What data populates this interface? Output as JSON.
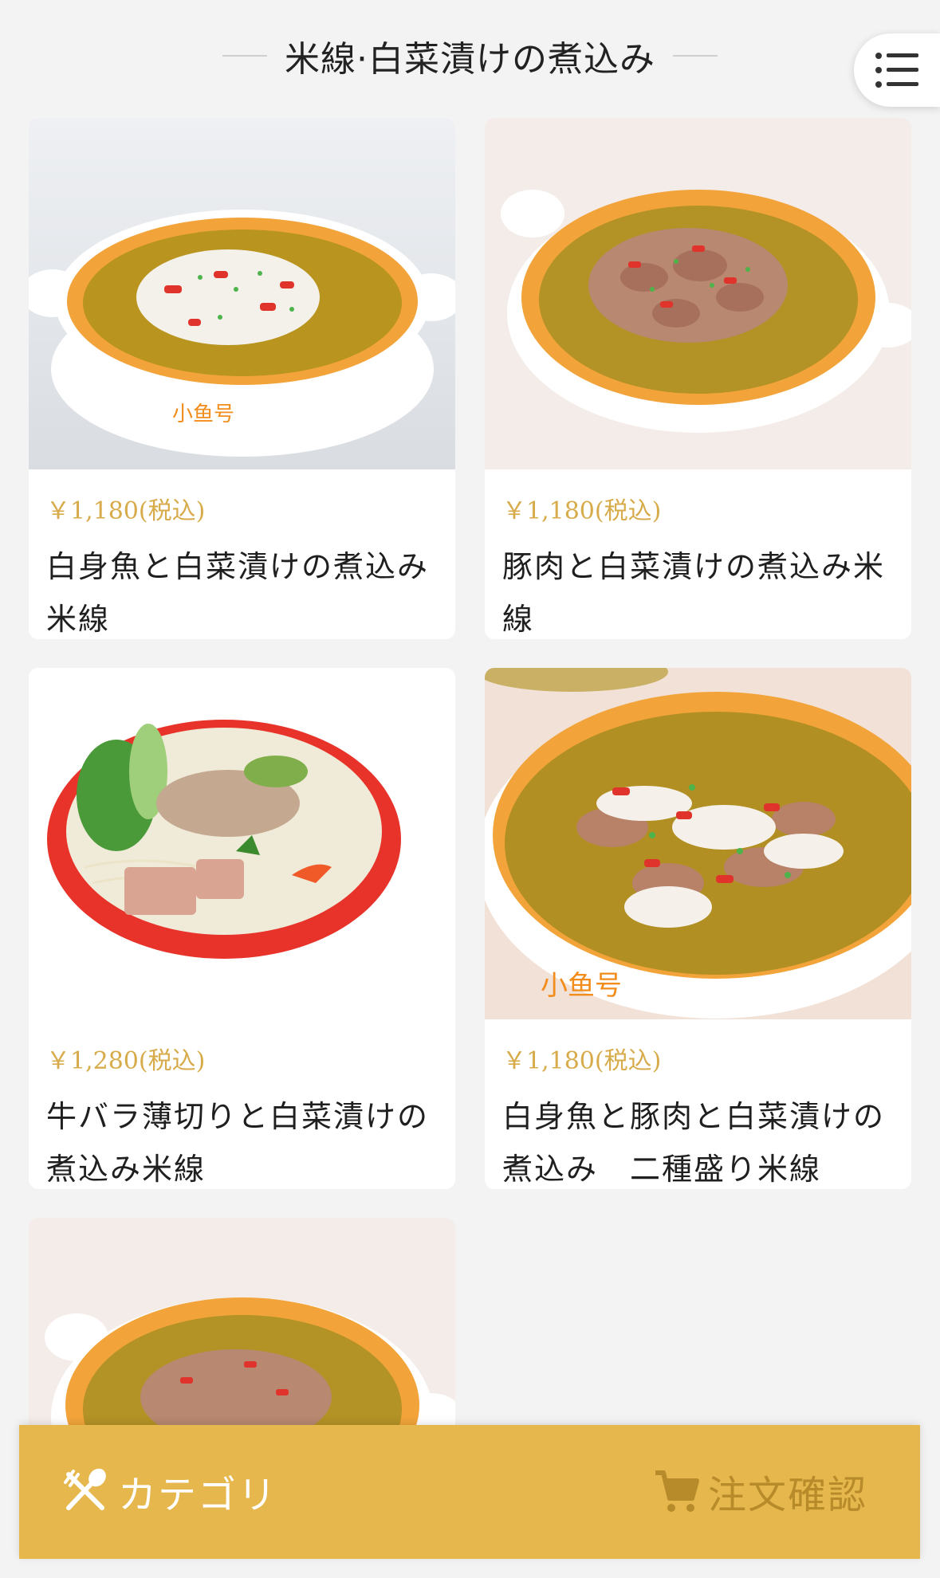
{
  "header": {
    "title": "米線·白菜漬けの煮込み",
    "menu_icon": "list-menu-icon"
  },
  "items": [
    {
      "price": "￥1,180(税込)",
      "name": "白身魚と白菜漬けの煮込み米線",
      "photo": "white-fish-noodle-bowl"
    },
    {
      "price": "￥1,180(税込)",
      "name": "豚肉と白菜漬けの煮込み米線",
      "photo": "pork-noodle-bowl"
    },
    {
      "price": "￥1,280(税込)",
      "name": "牛バラ薄切りと白菜漬けの煮込み米線",
      "photo": "beef-noodle-red-bowl"
    },
    {
      "price": "￥1,180(税込)",
      "name": "白身魚と豚肉と白菜漬けの煮込み　二種盛り米線",
      "photo": "fish-pork-noodle-bowl"
    },
    {
      "photo": "pork-noodle-bowl-partial"
    }
  ],
  "bottom_bar": {
    "category_label": "カテゴリ",
    "order_label": "注文確認"
  },
  "colors": {
    "accent": "#e6b74c",
    "price": "#d7ab4a",
    "bowl_rim": "#f2a43a",
    "bowl_red": "#e8332a"
  }
}
